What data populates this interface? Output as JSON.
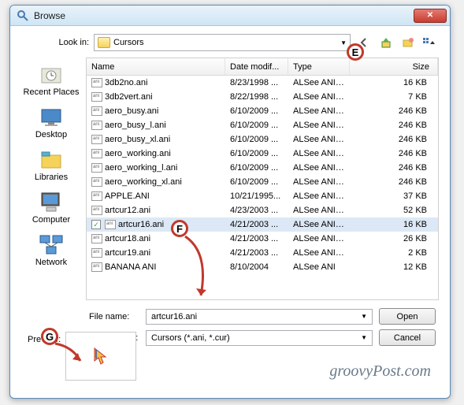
{
  "window": {
    "title": "Browse"
  },
  "lookin": {
    "label": "Look in:",
    "value": "Cursors"
  },
  "columns": {
    "name": "Name",
    "date": "Date modif...",
    "type": "Type",
    "size": "Size"
  },
  "places": [
    {
      "label": "Recent Places"
    },
    {
      "label": "Desktop"
    },
    {
      "label": "Libraries"
    },
    {
      "label": "Computer"
    },
    {
      "label": "Network"
    }
  ],
  "files": [
    {
      "name": "3db2no.ani",
      "date": "8/23/1998 ...",
      "type": "ALSee ANI ...",
      "size": "16 KB",
      "sel": false
    },
    {
      "name": "3db2vert.ani",
      "date": "8/22/1998 ...",
      "type": "ALSee ANI ...",
      "size": "7 KB",
      "sel": false
    },
    {
      "name": "aero_busy.ani",
      "date": "6/10/2009 ...",
      "type": "ALSee ANI ...",
      "size": "246 KB",
      "sel": false
    },
    {
      "name": "aero_busy_l.ani",
      "date": "6/10/2009 ...",
      "type": "ALSee ANI ...",
      "size": "246 KB",
      "sel": false
    },
    {
      "name": "aero_busy_xl.ani",
      "date": "6/10/2009 ...",
      "type": "ALSee ANI ...",
      "size": "246 KB",
      "sel": false
    },
    {
      "name": "aero_working.ani",
      "date": "6/10/2009 ...",
      "type": "ALSee ANI ...",
      "size": "246 KB",
      "sel": false
    },
    {
      "name": "aero_working_l.ani",
      "date": "6/10/2009 ...",
      "type": "ALSee ANI ...",
      "size": "246 KB",
      "sel": false
    },
    {
      "name": "aero_working_xl.ani",
      "date": "6/10/2009 ...",
      "type": "ALSee ANI ...",
      "size": "246 KB",
      "sel": false
    },
    {
      "name": "APPLE.ANI",
      "date": "10/21/1995...",
      "type": "ALSee ANI ...",
      "size": "37 KB",
      "sel": false
    },
    {
      "name": "artcur12.ani",
      "date": "4/23/2003 ...",
      "type": "ALSee ANI ...",
      "size": "52 KB",
      "sel": false
    },
    {
      "name": "artcur16.ani",
      "date": "4/21/2003 ...",
      "type": "ALSee ANI ...",
      "size": "16 KB",
      "sel": true
    },
    {
      "name": "artcur18.ani",
      "date": "4/21/2003 ...",
      "type": "ALSee ANI ...",
      "size": "26 KB",
      "sel": false
    },
    {
      "name": "artcur19.ani",
      "date": "4/21/2003 ...",
      "type": "ALSee ANI ...",
      "size": "2 KB",
      "sel": false
    },
    {
      "name": "BANANA ANI",
      "date": "8/10/2004",
      "type": "ALSee ANI",
      "size": "12 KB",
      "sel": false
    }
  ],
  "filename": {
    "label": "File name:",
    "value": "artcur16.ani"
  },
  "filetype": {
    "label": "Files of type:",
    "value": "Cursors (*.ani, *.cur)"
  },
  "buttons": {
    "open": "Open",
    "cancel": "Cancel"
  },
  "preview": {
    "label": "Preview:"
  },
  "watermark": "groovyPost.com",
  "callouts": {
    "e": "E",
    "f": "F",
    "g": "G"
  }
}
